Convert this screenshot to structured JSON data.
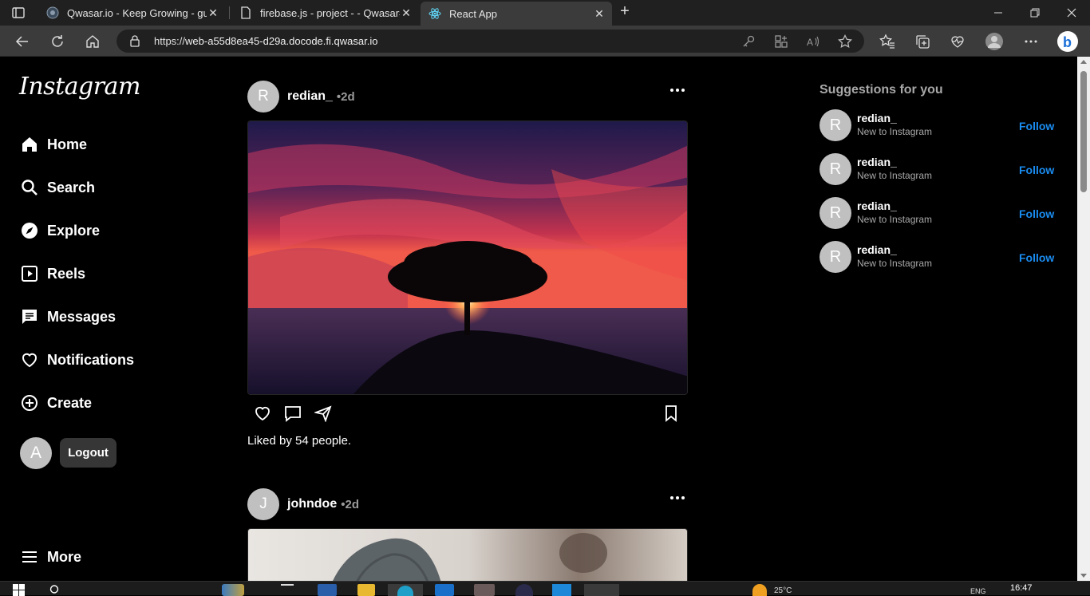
{
  "browser": {
    "tabs": [
      {
        "title": "Qwasar.io - Keep Growing - gulm",
        "active": false
      },
      {
        "title": "firebase.js - project - - Qwasar#D",
        "active": false
      },
      {
        "title": "React App",
        "active": true
      }
    ],
    "url_prefix": "https://",
    "url_host": "web-a55d8ea45-d29a.docode.fi.qwasar.io"
  },
  "sidebar": {
    "logo": "Instagram",
    "items": [
      {
        "label": "Home",
        "icon": "home-icon"
      },
      {
        "label": "Search",
        "icon": "search-icon"
      },
      {
        "label": "Explore",
        "icon": "compass-icon"
      },
      {
        "label": "Reels",
        "icon": "reels-icon"
      },
      {
        "label": "Messages",
        "icon": "messages-icon"
      },
      {
        "label": "Notifications",
        "icon": "heart-icon"
      },
      {
        "label": "Create",
        "icon": "plus-circle-icon"
      }
    ],
    "user_initial": "A",
    "logout_label": "Logout",
    "more_label": "More"
  },
  "feed": {
    "posts": [
      {
        "initial": "R",
        "username": "redian_",
        "time": "•2d",
        "likes_text": "Liked by 54 people.",
        "image": "sunset-tree"
      },
      {
        "initial": "J",
        "username": "johndoe",
        "time": "•2d",
        "image": "person-beanie"
      }
    ]
  },
  "suggestions": {
    "title": "Suggestions for you",
    "items": [
      {
        "initial": "R",
        "name": "redian_",
        "subtitle": "New to Instagram",
        "action": "Follow"
      },
      {
        "initial": "R",
        "name": "redian_",
        "subtitle": "New to Instagram",
        "action": "Follow"
      },
      {
        "initial": "R",
        "name": "redian_",
        "subtitle": "New to Instagram",
        "action": "Follow"
      },
      {
        "initial": "R",
        "name": "redian_",
        "subtitle": "New to Instagram",
        "action": "Follow"
      }
    ]
  },
  "taskbar": {
    "weather": "25°C",
    "lang": "ENG",
    "time": "16:47"
  },
  "colors": {
    "accent": "#1a8cf0",
    "background": "#000000",
    "avatar": "#c0c0c0"
  }
}
